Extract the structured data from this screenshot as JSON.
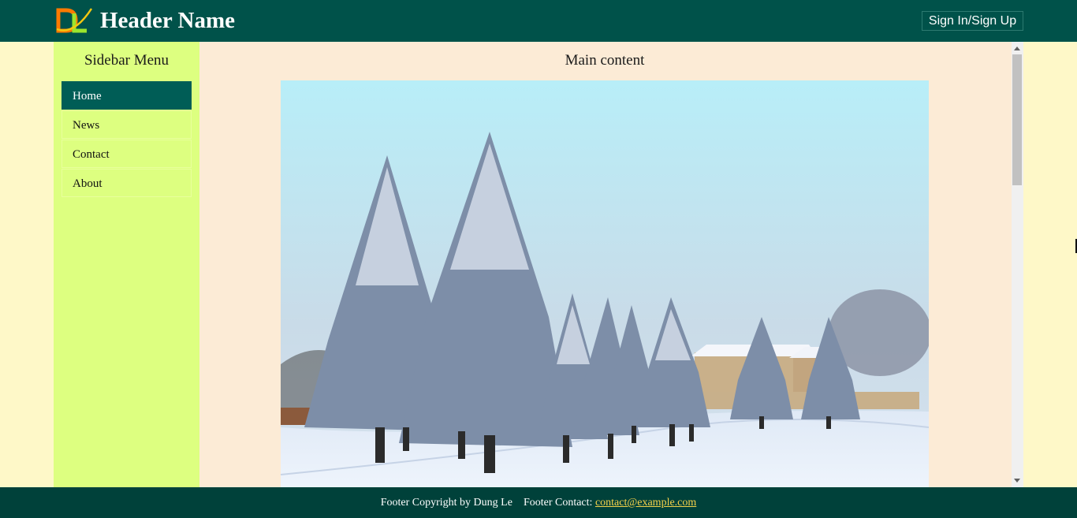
{
  "header": {
    "logo_text": "DL",
    "title": "Header Name",
    "sign_in_label": "Sign In/Sign Up"
  },
  "sidebar": {
    "title": "Sidebar Menu",
    "items": [
      {
        "label": "Home",
        "active": true
      },
      {
        "label": "News",
        "active": false
      },
      {
        "label": "Contact",
        "active": false
      },
      {
        "label": "About",
        "active": false
      }
    ]
  },
  "main": {
    "title": "Main content",
    "image_icon": "winter-landscape-photo"
  },
  "footer": {
    "copyright": "Footer Copyright by Dung Le",
    "contact_prefix": "Footer Contact:",
    "contact_email": "contact@example.com"
  },
  "colors": {
    "header_bg": "#00524a",
    "footer_bg": "#00413a",
    "sidebar_bg": "#ddff80",
    "main_bg": "#fcebd6",
    "page_bg": "#fef8c8",
    "active_item": "#005d56",
    "link": "#f5d24a"
  }
}
